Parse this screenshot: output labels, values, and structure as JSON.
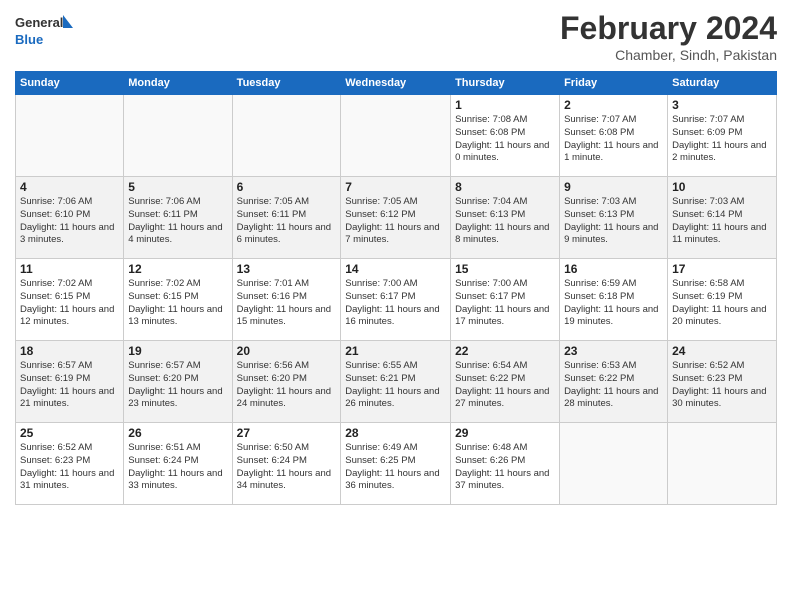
{
  "logo": {
    "line1": "General",
    "line2": "Blue"
  },
  "title": "February 2024",
  "subtitle": "Chamber, Sindh, Pakistan",
  "days_of_week": [
    "Sunday",
    "Monday",
    "Tuesday",
    "Wednesday",
    "Thursday",
    "Friday",
    "Saturday"
  ],
  "weeks": [
    [
      {
        "num": "",
        "info": ""
      },
      {
        "num": "",
        "info": ""
      },
      {
        "num": "",
        "info": ""
      },
      {
        "num": "",
        "info": ""
      },
      {
        "num": "1",
        "info": "Sunrise: 7:08 AM\nSunset: 6:08 PM\nDaylight: 11 hours\nand 0 minutes."
      },
      {
        "num": "2",
        "info": "Sunrise: 7:07 AM\nSunset: 6:08 PM\nDaylight: 11 hours\nand 1 minute."
      },
      {
        "num": "3",
        "info": "Sunrise: 7:07 AM\nSunset: 6:09 PM\nDaylight: 11 hours\nand 2 minutes."
      }
    ],
    [
      {
        "num": "4",
        "info": "Sunrise: 7:06 AM\nSunset: 6:10 PM\nDaylight: 11 hours\nand 3 minutes."
      },
      {
        "num": "5",
        "info": "Sunrise: 7:06 AM\nSunset: 6:11 PM\nDaylight: 11 hours\nand 4 minutes."
      },
      {
        "num": "6",
        "info": "Sunrise: 7:05 AM\nSunset: 6:11 PM\nDaylight: 11 hours\nand 6 minutes."
      },
      {
        "num": "7",
        "info": "Sunrise: 7:05 AM\nSunset: 6:12 PM\nDaylight: 11 hours\nand 7 minutes."
      },
      {
        "num": "8",
        "info": "Sunrise: 7:04 AM\nSunset: 6:13 PM\nDaylight: 11 hours\nand 8 minutes."
      },
      {
        "num": "9",
        "info": "Sunrise: 7:03 AM\nSunset: 6:13 PM\nDaylight: 11 hours\nand 9 minutes."
      },
      {
        "num": "10",
        "info": "Sunrise: 7:03 AM\nSunset: 6:14 PM\nDaylight: 11 hours\nand 11 minutes."
      }
    ],
    [
      {
        "num": "11",
        "info": "Sunrise: 7:02 AM\nSunset: 6:15 PM\nDaylight: 11 hours\nand 12 minutes."
      },
      {
        "num": "12",
        "info": "Sunrise: 7:02 AM\nSunset: 6:15 PM\nDaylight: 11 hours\nand 13 minutes."
      },
      {
        "num": "13",
        "info": "Sunrise: 7:01 AM\nSunset: 6:16 PM\nDaylight: 11 hours\nand 15 minutes."
      },
      {
        "num": "14",
        "info": "Sunrise: 7:00 AM\nSunset: 6:17 PM\nDaylight: 11 hours\nand 16 minutes."
      },
      {
        "num": "15",
        "info": "Sunrise: 7:00 AM\nSunset: 6:17 PM\nDaylight: 11 hours\nand 17 minutes."
      },
      {
        "num": "16",
        "info": "Sunrise: 6:59 AM\nSunset: 6:18 PM\nDaylight: 11 hours\nand 19 minutes."
      },
      {
        "num": "17",
        "info": "Sunrise: 6:58 AM\nSunset: 6:19 PM\nDaylight: 11 hours\nand 20 minutes."
      }
    ],
    [
      {
        "num": "18",
        "info": "Sunrise: 6:57 AM\nSunset: 6:19 PM\nDaylight: 11 hours\nand 21 minutes."
      },
      {
        "num": "19",
        "info": "Sunrise: 6:57 AM\nSunset: 6:20 PM\nDaylight: 11 hours\nand 23 minutes."
      },
      {
        "num": "20",
        "info": "Sunrise: 6:56 AM\nSunset: 6:20 PM\nDaylight: 11 hours\nand 24 minutes."
      },
      {
        "num": "21",
        "info": "Sunrise: 6:55 AM\nSunset: 6:21 PM\nDaylight: 11 hours\nand 26 minutes."
      },
      {
        "num": "22",
        "info": "Sunrise: 6:54 AM\nSunset: 6:22 PM\nDaylight: 11 hours\nand 27 minutes."
      },
      {
        "num": "23",
        "info": "Sunrise: 6:53 AM\nSunset: 6:22 PM\nDaylight: 11 hours\nand 28 minutes."
      },
      {
        "num": "24",
        "info": "Sunrise: 6:52 AM\nSunset: 6:23 PM\nDaylight: 11 hours\nand 30 minutes."
      }
    ],
    [
      {
        "num": "25",
        "info": "Sunrise: 6:52 AM\nSunset: 6:23 PM\nDaylight: 11 hours\nand 31 minutes."
      },
      {
        "num": "26",
        "info": "Sunrise: 6:51 AM\nSunset: 6:24 PM\nDaylight: 11 hours\nand 33 minutes."
      },
      {
        "num": "27",
        "info": "Sunrise: 6:50 AM\nSunset: 6:24 PM\nDaylight: 11 hours\nand 34 minutes."
      },
      {
        "num": "28",
        "info": "Sunrise: 6:49 AM\nSunset: 6:25 PM\nDaylight: 11 hours\nand 36 minutes."
      },
      {
        "num": "29",
        "info": "Sunrise: 6:48 AM\nSunset: 6:26 PM\nDaylight: 11 hours\nand 37 minutes."
      },
      {
        "num": "",
        "info": ""
      },
      {
        "num": "",
        "info": ""
      }
    ]
  ]
}
